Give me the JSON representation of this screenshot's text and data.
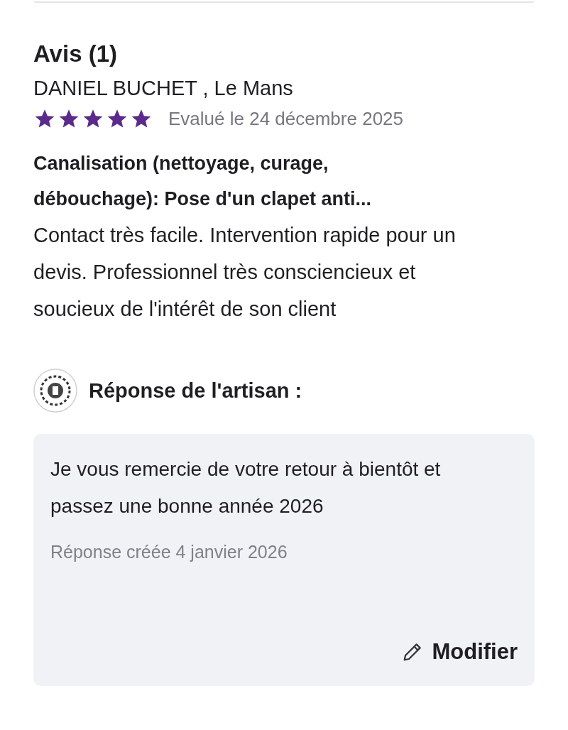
{
  "reviews_section": {
    "title": "Avis (1)"
  },
  "review": {
    "author": "DANIEL BUCHET , Le Mans",
    "stars": 5,
    "date": "Evalué le 24 décembre 2025",
    "headline": "Canalisation (nettoyage, curage, débouchage): Pose d'un clapet anti...",
    "text": "Contact très facile. Intervention rapide pour un devis. Professionnel très consciencieux et soucieux de l'intérêt de son client"
  },
  "response": {
    "heading": "Réponse de l'artisan :",
    "text": "Je vous remercie de votre retour à bientôt et passez une bonne année 2026",
    "date": "Réponse créée 4 janvier 2026",
    "edit_button": "Modifier"
  }
}
